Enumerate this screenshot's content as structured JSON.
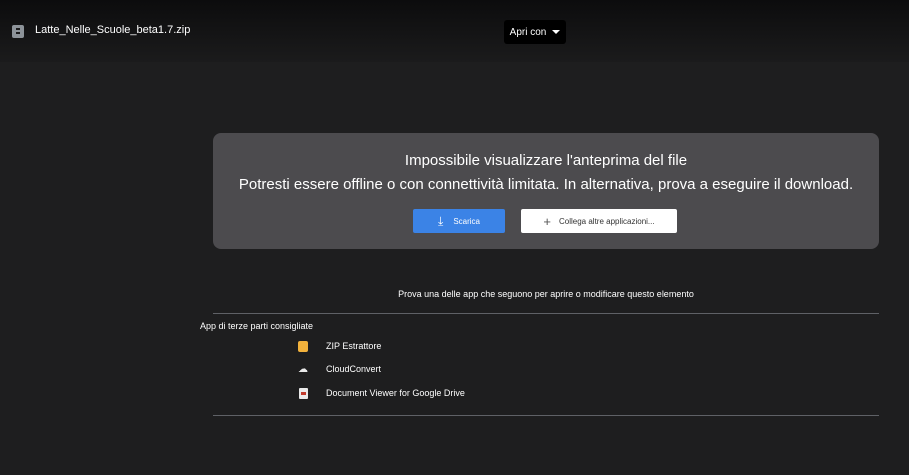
{
  "header": {
    "file_name": "Latte_Nelle_Scuole_beta1.7.zip",
    "open_with_label": "Apri con"
  },
  "preview_error": {
    "title": "Impossibile visualizzare l'anteprima del file",
    "message": "Potresti essere offline o con connettività limitata. In alternativa, prova a eseguire il download.",
    "download_label": "Scarica",
    "connect_apps_label": "Collega altre applicazioni..."
  },
  "suggestions": {
    "prompt": "Prova una delle app che seguono per aprire o modificare questo elemento",
    "section_title": "App di terze parti consigliate",
    "apps": [
      {
        "label": "ZIP Estrattore",
        "icon": "zip-extractor-icon"
      },
      {
        "label": "CloudConvert",
        "icon": "cloudconvert-icon"
      },
      {
        "label": "Document Viewer for Google Drive",
        "icon": "document-viewer-icon"
      }
    ]
  },
  "colors": {
    "background": "#1e1e1f",
    "card": "#4c4b4e",
    "primary_button": "#3b83e6"
  }
}
